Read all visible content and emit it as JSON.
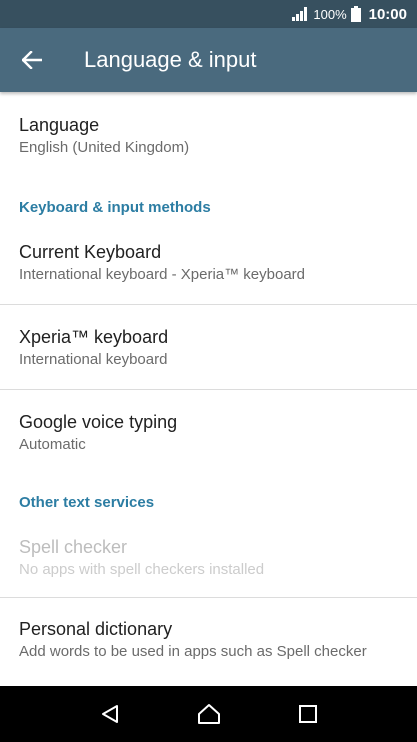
{
  "status_bar": {
    "battery_percent": "100%",
    "time": "10:00"
  },
  "app_bar": {
    "title": "Language & input",
    "back_icon": "arrow-back-icon"
  },
  "items": {
    "language": {
      "title": "Language",
      "summary": "English (United Kingdom)"
    },
    "keyboard_section": "Keyboard & input methods",
    "current_keyboard": {
      "title": "Current Keyboard",
      "summary": "International keyboard - Xperia™ keyboard"
    },
    "xperia_keyboard": {
      "title": "Xperia™ keyboard",
      "summary": "International keyboard"
    },
    "google_voice": {
      "title": "Google voice typing",
      "summary": "Automatic"
    },
    "other_section": "Other text services",
    "spell_checker": {
      "title": "Spell checker",
      "summary": "No apps with spell checkers installed",
      "enabled": false
    },
    "personal_dictionary": {
      "title": "Personal dictionary",
      "summary": "Add words to be used in apps such as Spell checker"
    }
  },
  "nav_bar": {
    "back": "back-triangle-icon",
    "home": "home-icon",
    "recents": "recents-square-icon"
  },
  "colors": {
    "status_bar": "#37505f",
    "app_bar": "#4a6a7e",
    "accent": "#2c7da3"
  }
}
